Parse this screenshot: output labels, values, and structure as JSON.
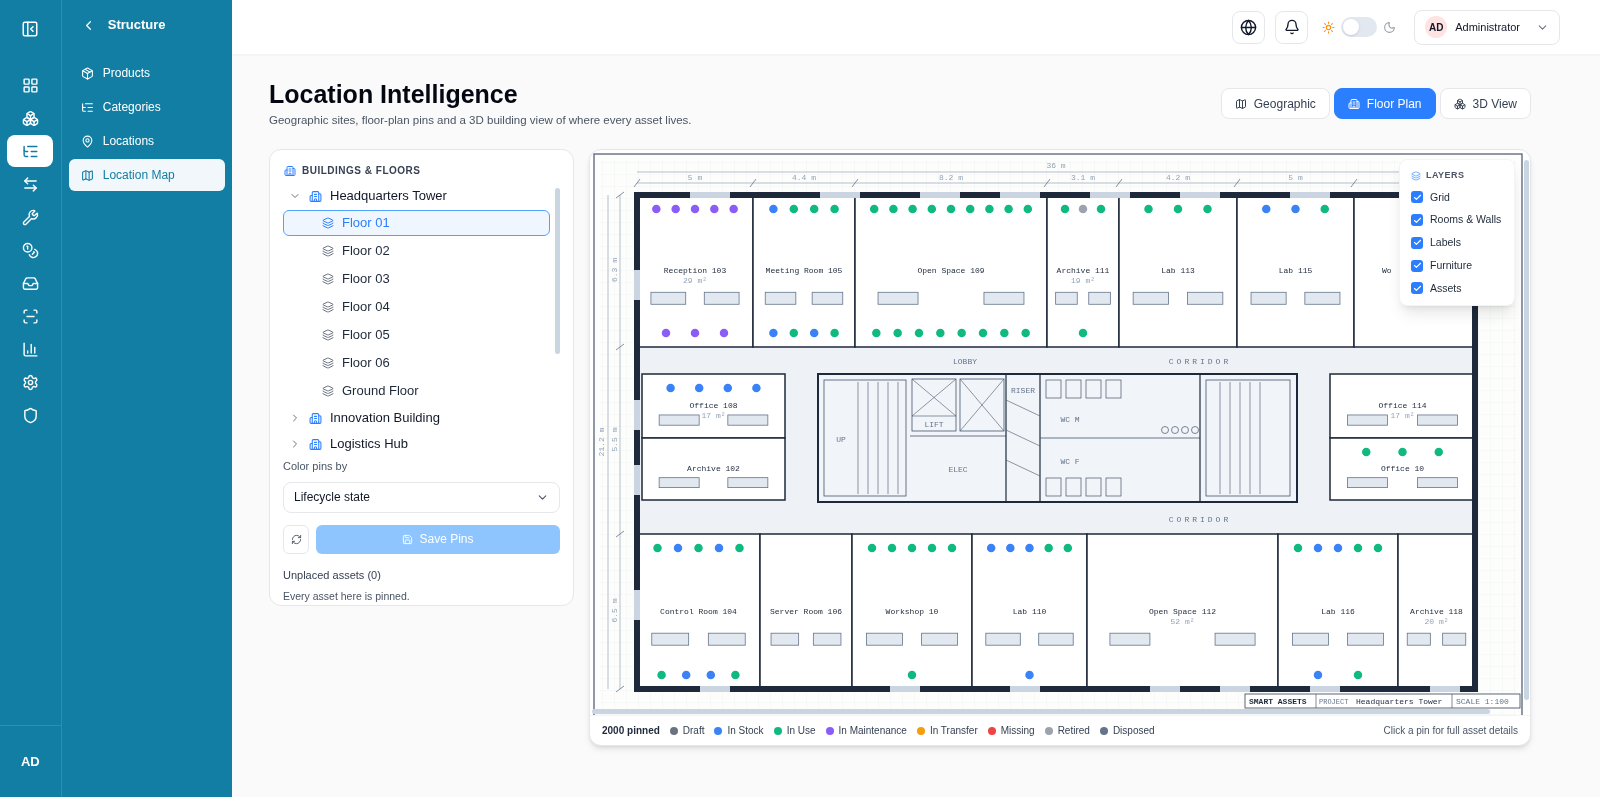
{
  "rail": {
    "items": [
      {
        "selected": false
      },
      {
        "selected": false
      },
      {
        "selected": true
      },
      {
        "selected": false
      },
      {
        "selected": false
      },
      {
        "selected": false
      },
      {
        "selected": false
      },
      {
        "selected": false
      },
      {
        "selected": false
      },
      {
        "selected": false
      },
      {
        "selected": false
      }
    ],
    "user_initials": "AD"
  },
  "subnav": {
    "title": "Structure",
    "items": [
      {
        "label": "Products",
        "selected": false
      },
      {
        "label": "Categories",
        "selected": false
      },
      {
        "label": "Locations",
        "selected": false
      },
      {
        "label": "Location Map",
        "selected": true
      }
    ]
  },
  "header": {
    "theme_toggle": {
      "on": false
    },
    "user": {
      "initials": "AD",
      "name": "Administrator"
    }
  },
  "page": {
    "title": "Location Intelligence",
    "subtitle": "Geographic sites, floor-plan pins and a 3D building view of where every asset lives.",
    "tabs": [
      {
        "label": "Geographic",
        "selected": false
      },
      {
        "label": "Floor Plan",
        "selected": true
      },
      {
        "label": "3D View",
        "selected": false
      }
    ]
  },
  "buildings_panel": {
    "title": "BUILDINGS & FLOORS",
    "tree": [
      {
        "label": "Headquarters Tower",
        "expanded": true,
        "children": [
          {
            "label": "Floor 01",
            "selected": true
          },
          {
            "label": "Floor 02",
            "selected": false
          },
          {
            "label": "Floor 03",
            "selected": false
          },
          {
            "label": "Floor 04",
            "selected": false
          },
          {
            "label": "Floor 05",
            "selected": false
          },
          {
            "label": "Floor 06",
            "selected": false
          },
          {
            "label": "Ground Floor",
            "selected": false
          }
        ]
      },
      {
        "label": "Innovation Building",
        "expanded": false
      },
      {
        "label": "Logistics Hub",
        "expanded": false
      }
    ],
    "color_by_label": "Color pins by",
    "color_by_value": "Lifecycle state",
    "save_button": {
      "label": "Save Pins",
      "disabled": true
    },
    "unplaced_title": "Unplaced assets (0)",
    "unplaced_note": "Every asset here is pinned."
  },
  "floor_plan": {
    "layers_title": "LAYERS",
    "layers": [
      {
        "kind": "grid",
        "label": "Grid",
        "checked": true
      },
      {
        "kind": "rooms",
        "label": "Rooms & Walls",
        "checked": true
      },
      {
        "kind": "labels",
        "label": "Labels",
        "checked": true
      },
      {
        "kind": "furniture",
        "label": "Furniture",
        "checked": true
      },
      {
        "kind": "assets",
        "label": "Assets",
        "checked": true
      }
    ],
    "dimensions_top": [
      "5 m",
      "4.4 m",
      "8.2 m",
      "3.1 m",
      "4.2 m",
      "5 m"
    ],
    "total_width": "36 m",
    "dimensions_left": [
      "6.3 m",
      "5.5 m",
      "6.5 m"
    ],
    "total_height": "21.2 m",
    "corridors": [
      "CORRIDOR",
      "CORRIDOR"
    ],
    "lobby": "LOBBY",
    "core_labels": [
      "UP",
      "LIFT",
      "ELEC",
      "RISER",
      "WC M",
      "WC F"
    ],
    "rooms": [
      {
        "name": "Reception 103",
        "area": "29 m²",
        "pins": [
          {
            "color": "#8b5cf6"
          },
          {
            "color": "#8b5cf6"
          },
          {
            "color": "#8b5cf6"
          },
          {
            "color": "#8b5cf6"
          },
          {
            "color": "#8b5cf6"
          },
          {
            "color": "#8b5cf6"
          },
          {
            "color": "#8b5cf6"
          },
          {
            "color": "#8b5cf6"
          }
        ]
      },
      {
        "name": "Meeting Room 105",
        "pins": [
          {
            "color": "#3b82f6"
          },
          {
            "color": "#10b981"
          },
          {
            "color": "#10b981"
          },
          {
            "color": "#10b981"
          },
          {
            "color": "#3b82f6"
          },
          {
            "color": "#10b981"
          },
          {
            "color": "#3b82f6"
          },
          {
            "color": "#10b981"
          }
        ]
      },
      {
        "name": "Open Space 109",
        "pins": [
          {
            "color": "#10b981"
          },
          {
            "color": "#10b981"
          },
          {
            "color": "#10b981"
          },
          {
            "color": "#10b981"
          },
          {
            "color": "#10b981"
          },
          {
            "color": "#10b981"
          },
          {
            "color": "#10b981"
          },
          {
            "color": "#10b981"
          },
          {
            "color": "#10b981"
          },
          {
            "color": "#10b981"
          },
          {
            "color": "#10b981"
          },
          {
            "color": "#10b981"
          },
          {
            "color": "#10b981"
          },
          {
            "color": "#10b981"
          },
          {
            "color": "#10b981"
          },
          {
            "color": "#10b981"
          },
          {
            "color": "#10b981"
          }
        ]
      },
      {
        "name": "Archive 111",
        "area": "19 m²",
        "pins": [
          {
            "color": "#10b981"
          },
          {
            "color": "#9ca3af"
          },
          {
            "color": "#10b981"
          },
          {
            "color": "#10b981"
          }
        ]
      },
      {
        "name": "Lab 113",
        "pins": [
          {
            "color": "#10b981"
          },
          {
            "color": "#10b981"
          },
          {
            "color": "#10b981"
          }
        ]
      },
      {
        "name": "Lab 115",
        "pins": [
          {
            "color": "#3b82f6"
          },
          {
            "color": "#3b82f6"
          },
          {
            "color": "#10b981"
          }
        ]
      },
      {
        "name": "Wo"
      },
      {
        "name": "Office 108",
        "area": "17 m²",
        "pins": [
          {
            "color": "#3b82f6"
          },
          {
            "color": "#3b82f6"
          },
          {
            "color": "#3b82f6"
          },
          {
            "color": "#3b82f6"
          }
        ]
      },
      {
        "name": "Archive 102"
      },
      {
        "name": "Office 114",
        "area": "17 m²"
      },
      {
        "name": "Office 10",
        "pins": [
          {
            "color": "#10b981"
          },
          {
            "color": "#10b981"
          },
          {
            "color": "#10b981"
          }
        ]
      },
      {
        "name": "Control Room 104",
        "pins": [
          {
            "color": "#10b981"
          },
          {
            "color": "#3b82f6"
          },
          {
            "color": "#10b981"
          },
          {
            "color": "#3b82f6"
          },
          {
            "color": "#10b981"
          },
          {
            "color": "#10b981"
          },
          {
            "color": "#3b82f6"
          },
          {
            "color": "#3b82f6"
          },
          {
            "color": "#10b981"
          }
        ]
      },
      {
        "name": "Server Room 106"
      },
      {
        "name": "Workshop 10",
        "pins": [
          {
            "color": "#10b981"
          },
          {
            "color": "#10b981"
          },
          {
            "color": "#10b981"
          },
          {
            "color": "#10b981"
          },
          {
            "color": "#10b981"
          },
          {
            "color": "#10b981"
          }
        ]
      },
      {
        "name": "Lab 110",
        "pins": [
          {
            "color": "#3b82f6"
          },
          {
            "color": "#3b82f6"
          },
          {
            "color": "#3b82f6"
          },
          {
            "color": "#10b981"
          },
          {
            "color": "#10b981"
          },
          {
            "color": "#3b82f6"
          }
        ]
      },
      {
        "name": "Open Space 112",
        "area": "52 m²"
      },
      {
        "name": "Lab 116",
        "pins": [
          {
            "color": "#10b981"
          },
          {
            "color": "#3b82f6"
          },
          {
            "color": "#3b82f6"
          },
          {
            "color": "#10b981"
          },
          {
            "color": "#10b981"
          },
          {
            "color": "#3b82f6"
          },
          {
            "color": "#10b981"
          }
        ]
      },
      {
        "name": "Archive 118",
        "area": "20 m²"
      }
    ],
    "title_block": {
      "company": "SMART ASSETS",
      "project_label": "PROJECT",
      "project": "Headquarters Tower",
      "scale": "SCALE 1:100"
    }
  },
  "legend": {
    "count": "2000 pinned",
    "states": [
      {
        "label": "Draft",
        "color": "#6b7280"
      },
      {
        "label": "In Stock",
        "color": "#3b82f6"
      },
      {
        "label": "In Use",
        "color": "#10b981"
      },
      {
        "label": "In Maintenance",
        "color": "#8b5cf6"
      },
      {
        "label": "In Transfer",
        "color": "#f59e0b"
      },
      {
        "label": "Missing",
        "color": "#ef4444"
      },
      {
        "label": "Retired",
        "color": "#9ca3af"
      },
      {
        "label": "Disposed",
        "color": "#64748b"
      }
    ],
    "hint": "Click a pin for full asset details"
  }
}
